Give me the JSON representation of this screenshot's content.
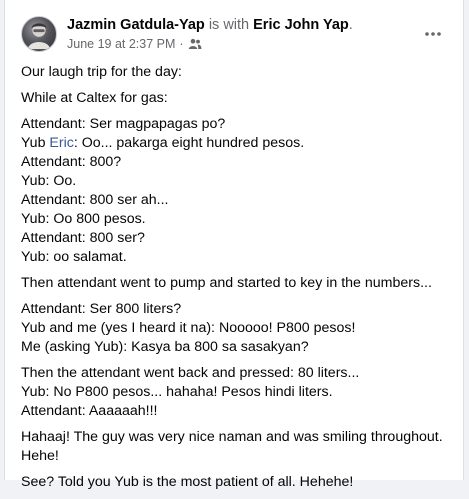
{
  "post": {
    "author": "Jazmin Gatdula-Yap",
    "with_text": " is with ",
    "tagged": "Eric John Yap",
    "tagged_suffix": ".",
    "timestamp": "June 19 at 2:37 PM",
    "separator": "·",
    "audience_icon": "friends-icon",
    "more_icon": "more-options-icon"
  },
  "content": {
    "p1": "Our laugh trip for the day:",
    "p2": "While at Caltex for gas:",
    "p3": {
      "l1": "Attendant: Ser magpapagas po?",
      "l2_pre": "Yub ",
      "l2_mention": "Eric",
      "l2_post": ": Oo... pakarga eight hundred pesos.",
      "l3": "Attendant: 800?",
      "l4": "Yub: Oo.",
      "l5": "Attendant: 800 ser ah...",
      "l6": "Yub: Oo 800 pesos.",
      "l7": "Attendant: 800 ser?",
      "l8": "Yub: oo salamat."
    },
    "p4": "Then attendant went to pump and started to key in the numbers...",
    "p5": {
      "l1": "Attendant: Ser 800 liters?",
      "l2": "Yub and me (yes I heard it na): Nooooo! P800 pesos!",
      "l3": "Me (asking Yub): Kasya ba 800 sa sasakyan?"
    },
    "p6": {
      "l1": "Then the attendant went back and pressed: 80 liters...",
      "l2": "Yub: No P800 pesos... hahaha! Pesos hindi liters.",
      "l3": "Attendant: Aaaaaah!!!"
    },
    "p7": {
      "l1": "Hahaaj! The guy was very nice naman and was smiling throughout.",
      "l2": "Hehe!"
    },
    "p8": "See? Told you Yub is the most patient of all. Hehehe!"
  },
  "colors": {
    "mention": "#385898",
    "text": "#050505",
    "secondary": "#65676b"
  }
}
